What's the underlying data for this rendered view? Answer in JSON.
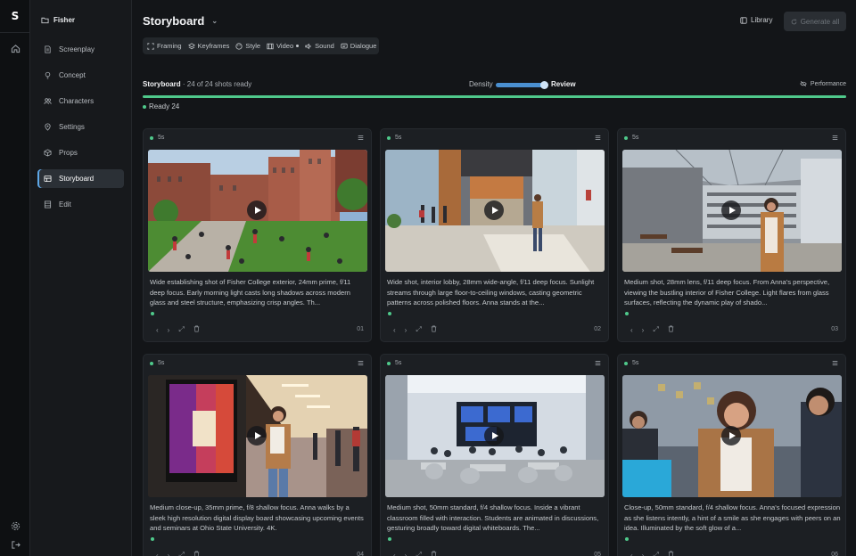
{
  "rail": {
    "logo": "S",
    "icons": [
      "home-icon",
      "settings-icon",
      "logout-icon"
    ]
  },
  "sidebar": {
    "project": "Fisher",
    "items": [
      {
        "label": "Screenplay",
        "icon": "document-icon",
        "active": false
      },
      {
        "label": "Concept",
        "icon": "lightbulb-icon",
        "active": false
      },
      {
        "label": "Characters",
        "icon": "users-icon",
        "active": false
      },
      {
        "label": "Settings",
        "icon": "map-pin-icon",
        "active": false
      },
      {
        "label": "Props",
        "icon": "box-icon",
        "active": false
      },
      {
        "label": "Storyboard",
        "icon": "storyboard-icon",
        "active": true
      },
      {
        "label": "Edit",
        "icon": "film-icon",
        "active": false
      }
    ]
  },
  "header": {
    "title": "Storyboard",
    "library": "Library",
    "generate_all": "Generate all"
  },
  "toolbar": {
    "items": [
      {
        "label": "Framing",
        "icon": "framing-icon"
      },
      {
        "label": "Keyframes",
        "icon": "layers-icon"
      },
      {
        "label": "Style",
        "icon": "palette-icon"
      },
      {
        "label": "Video",
        "icon": "video-icon"
      },
      {
        "label": "Sound",
        "icon": "speaker-icon"
      },
      {
        "label": "Dialogue",
        "icon": "dialogue-icon"
      }
    ]
  },
  "status": {
    "title": "Storyboard",
    "count": "· 24 of 24 shots ready",
    "density_label": "Density",
    "density_value": 1.0,
    "review_label": "Review",
    "performance": "Performance",
    "progress": 1.0,
    "ready": "Ready 24"
  },
  "shots": [
    {
      "duration": "5s",
      "number": "01",
      "description": "Wide establishing shot of Fisher College exterior, 24mm prime, f/11 deep focus. Early morning light casts long shadows across modern glass and steel structure, emphasizing crisp angles. Th..."
    },
    {
      "duration": "5s",
      "number": "02",
      "description": "Wide shot, interior lobby, 28mm wide-angle, f/11 deep focus. Sunlight streams through large floor-to-ceiling windows, casting geometric patterns across polished floors. Anna stands at the..."
    },
    {
      "duration": "5s",
      "number": "03",
      "description": "Medium shot, 28mm lens, f/11 deep focus. From Anna's perspective, viewing the bustling interior of Fisher College. Light flares from glass surfaces, reflecting the dynamic play of shado..."
    },
    {
      "duration": "5s",
      "number": "04",
      "description": "Medium close-up, 35mm prime, f/8 shallow focus. Anna walks by a sleek high resolution digital display board showcasing upcoming events and seminars at Ohio State University. 4K."
    },
    {
      "duration": "5s",
      "number": "05",
      "description": "Medium shot, 50mm standard, f/4 shallow focus. Inside a vibrant classroom filled with interaction. Students are animated in discussions, gesturing broadly toward digital whiteboards. The..."
    },
    {
      "duration": "5s",
      "number": "06",
      "description": "Close-up, 50mm standard, f/4 shallow focus. Anna's focused expression as she listens intently, a hint of a smile as she engages with peers on an idea. Illuminated by the soft glow of a..."
    }
  ]
}
